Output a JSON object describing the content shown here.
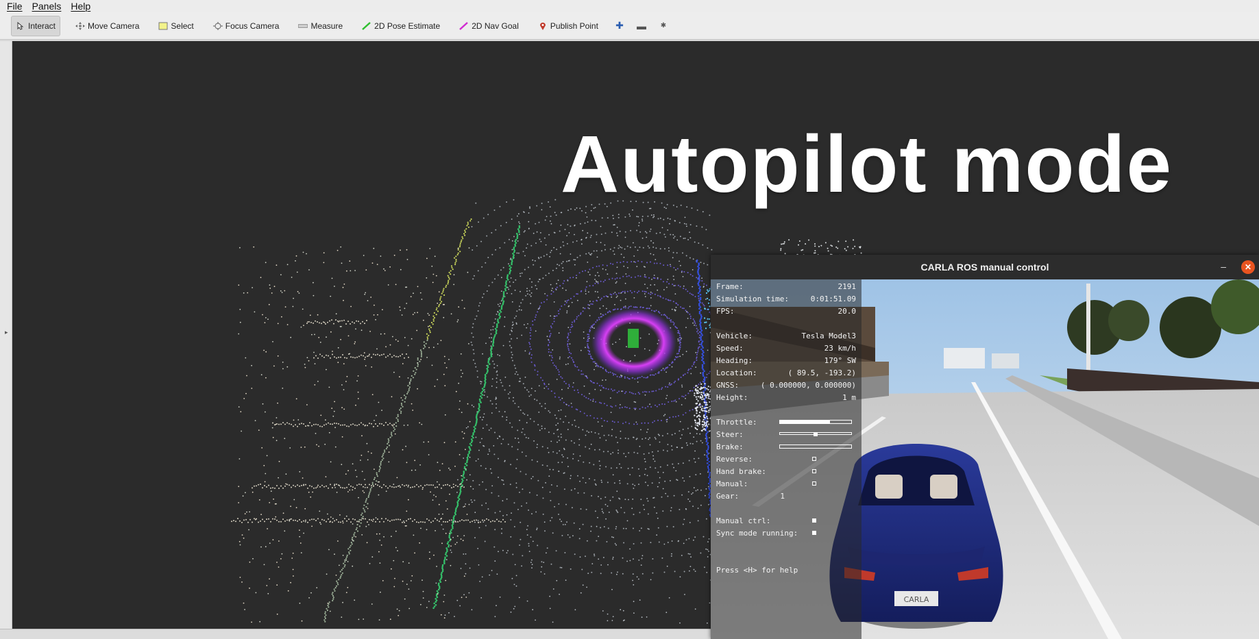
{
  "menubar": {
    "items": [
      "File",
      "Panels",
      "Help"
    ]
  },
  "toolbar": {
    "tools": [
      "Interact",
      "Move Camera",
      "Select",
      "Focus Camera",
      "Measure",
      "2D Pose Estimate",
      "2D Nav Goal",
      "Publish Point"
    ],
    "active": "Interact"
  },
  "overlay": {
    "title": "Autopilot mode"
  },
  "carla": {
    "window_title": "CARLA ROS manual control",
    "hud": {
      "frame_label": "Frame:",
      "frame_value": "2191",
      "sim_time_label": "Simulation time:",
      "sim_time_value": "0:01:51.09",
      "fps_label": "FPS:",
      "fps_value": "20.0",
      "vehicle_label": "Vehicle:",
      "vehicle_value": "Tesla Model3",
      "speed_label": "Speed:",
      "speed_value": "23 km/h",
      "heading_label": "Heading:",
      "heading_value": "179° SW",
      "location_label": "Location:",
      "location_value": "( 89.5, -193.2)",
      "gnss_label": "GNSS:",
      "gnss_value": "( 0.000000, 0.000000)",
      "height_label": "Height:",
      "height_value": "1 m",
      "throttle_label": "Throttle:",
      "throttle_level": 0.7,
      "steer_label": "Steer:",
      "steer_level": 0.5,
      "brake_label": "Brake:",
      "brake_level": 0.0,
      "reverse_label": "Reverse:",
      "reverse_on": false,
      "handbrake_label": "Hand brake:",
      "handbrake_on": false,
      "manual_label": "Manual:",
      "manual_on": false,
      "gear_label": "Gear:",
      "gear_value": "1",
      "manual_ctrl_label": "Manual ctrl:",
      "manual_ctrl_on": true,
      "sync_label": "Sync mode running:",
      "sync_on": true,
      "help_text": "Press <H> for help"
    },
    "plate_text": "CARLA"
  },
  "colors": {
    "accent_close": "#e95420",
    "viewport_bg": "#2b2b2b",
    "ring": "#cc33ff",
    "car_body": "#1e2a78"
  }
}
